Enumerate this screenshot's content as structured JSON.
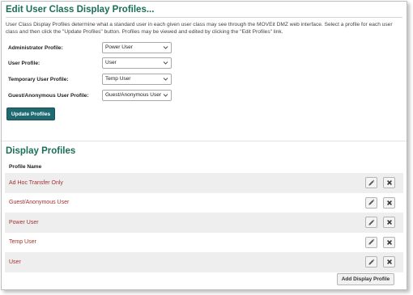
{
  "header": {
    "title": "Edit User Class Display Profiles...",
    "description": "User Class Display Profiles determine what a standard user in each given user class may see through the MOVEit DMZ web interface. Select a profile for each user class and then click the \"Update Profiles\" button. Profiles may be viewed and edited by clicking the \"Edit Profiles\" link."
  },
  "form": {
    "rows": [
      {
        "label": "Administrator Profile:",
        "value": "Power User"
      },
      {
        "label": "User Profile:",
        "value": "User"
      },
      {
        "label": "Temporary User Profile:",
        "value": "Temp User"
      },
      {
        "label": "Guest/Anonymous User Profile:",
        "value": "Guest/Anonymous User"
      }
    ],
    "update_label": "Update Profiles"
  },
  "profiles": {
    "title": "Display Profiles",
    "column": "Profile Name",
    "rows": [
      "Ad Hoc Transfer Only",
      "Guest/Anonymous User",
      "Power User",
      "Temp User",
      "User"
    ],
    "add_label": "Add Display Profile"
  },
  "icons": {
    "edit": "pencil-icon",
    "delete": "close-icon",
    "dropdown": "chevron-down-icon"
  },
  "colors": {
    "title": "#1a6f57",
    "primary_button": "#1e6a70",
    "link": "#a1322e",
    "row_alt": "#eeeeee"
  }
}
